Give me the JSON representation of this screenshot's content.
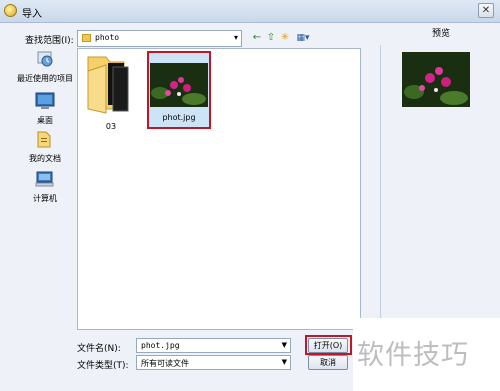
{
  "window": {
    "title": "导入",
    "close_label": "✕"
  },
  "toolbar": {
    "lookin_label": "查找范围(I):",
    "lookin_value": "photo",
    "lookin_arrow": "▾",
    "back_icon": "←",
    "up_icon": "⇧",
    "newfolder_icon": "✳",
    "view_icon": "▦▾"
  },
  "places": [
    {
      "label": "最近使用的项目",
      "icon": "recent-icon"
    },
    {
      "label": "桌面",
      "icon": "desktop-icon"
    },
    {
      "label": "我的文档",
      "icon": "documents-icon"
    },
    {
      "label": "计算机",
      "icon": "computer-icon"
    }
  ],
  "files": [
    {
      "name": "03",
      "type": "folder"
    },
    {
      "name": "phot.jpg",
      "type": "image",
      "selected": true
    }
  ],
  "preview": {
    "label": "预览"
  },
  "form": {
    "filename_label": "文件名(N):",
    "filename_value": "phot.jpg",
    "filetype_label": "文件类型(T):",
    "filetype_value": "所有可读文件",
    "arrow": "▼"
  },
  "buttons": {
    "open_label": "打开(O)",
    "cancel_label": "取消"
  },
  "watermark": "软件技巧",
  "colors": {
    "highlight": "#c0162a",
    "selection_bg": "#cde4f7"
  }
}
